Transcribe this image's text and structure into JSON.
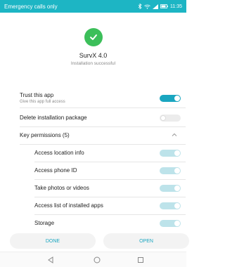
{
  "status_bar": {
    "left_text": "Emergency calls only",
    "right_text": "11:35",
    "bg_color": "#1db5c4"
  },
  "header": {
    "icon": "check-icon",
    "app_name": "SurvX 4.0",
    "status": "Installation successful",
    "accent_color": "#3cbf5a"
  },
  "settings": {
    "trust": {
      "label": "Trust this app",
      "sublabel": "Give this app full access",
      "enabled": true
    },
    "delete_package": {
      "label": "Delete installation package",
      "enabled": false
    },
    "key_permissions": {
      "label": "Key permissions (5)",
      "expanded": true
    }
  },
  "permissions": [
    {
      "label": "Access location info",
      "enabled": true
    },
    {
      "label": "Access phone ID",
      "enabled": true
    },
    {
      "label": "Take photos or videos",
      "enabled": true
    },
    {
      "label": "Access list of installed apps",
      "enabled": true
    },
    {
      "label": "Storage",
      "enabled": true
    }
  ],
  "buttons": {
    "done": "DONE",
    "open": "OPEN",
    "accent_color": "#1aa6c0"
  },
  "nav_bar": {
    "back_icon": "back-triangle-icon",
    "home_icon": "home-circle-icon",
    "recents_icon": "recents-square-icon"
  }
}
